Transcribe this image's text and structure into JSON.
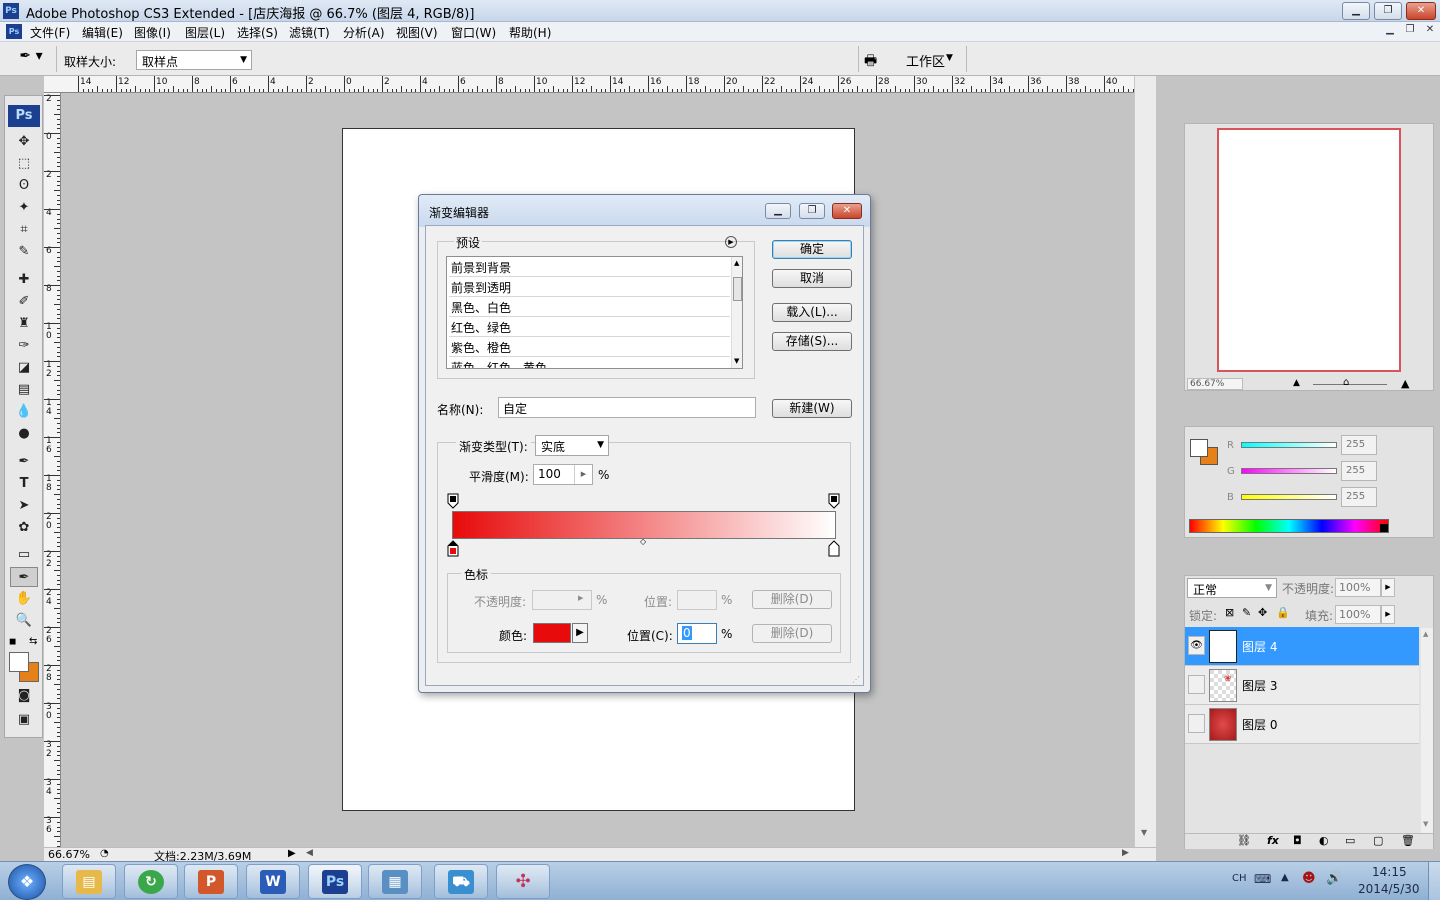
{
  "window": {
    "title": "Adobe Photoshop CS3 Extended - [店庆海报 @ 66.7% (图层 4, RGB/8)]",
    "ps_badge": "Ps"
  },
  "menu": [
    "文件(F)",
    "编辑(E)",
    "图像(I)",
    "图层(L)",
    "选择(S)",
    "滤镜(T)",
    "分析(A)",
    "视图(V)",
    "窗口(W)",
    "帮助(H)"
  ],
  "options": {
    "sample_size_label": "取样大小:",
    "sample_size_value": "取样点",
    "workspace": "工作区"
  },
  "toolbox": {
    "logo": "Ps",
    "tools": [
      "move-icon",
      "marquee-icon",
      "lasso-icon",
      "magic-wand-icon",
      "crop-icon",
      "slice-icon",
      "healing-brush-icon",
      "brush-icon",
      "clone-stamp-icon",
      "history-brush-icon",
      "eraser-icon",
      "gradient-icon",
      "blur-icon",
      "dodge-icon",
      "pen-icon",
      "type-icon",
      "path-select-icon",
      "shape-icon",
      "notes-icon",
      "eyedropper-icon",
      "hand-icon",
      "zoom-icon"
    ]
  },
  "rulers": {
    "h": [
      "14",
      "12",
      "10",
      "8",
      "6",
      "4",
      "2",
      "0",
      "2",
      "4",
      "6",
      "8",
      "10",
      "12",
      "14",
      "16",
      "18",
      "20",
      "22",
      "24",
      "26",
      "28",
      "30",
      "32",
      "34",
      "36",
      "38",
      "40"
    ],
    "v": [
      "2",
      "0",
      "2",
      "4",
      "6",
      "8",
      "1 0",
      "1 2",
      "1 4",
      "1 6",
      "1 8",
      "2 0",
      "2 2",
      "2 4",
      "2 6",
      "2 8",
      "3 0",
      "3 2",
      "3 4",
      "3 6"
    ]
  },
  "status": {
    "zoom": "66.67%",
    "doc": "文档:2.23M/3.69M"
  },
  "dialog": {
    "title": "渐变编辑器",
    "presets_label": "预设",
    "presets": [
      "前景到背景",
      "前景到透明",
      "黑色、白色",
      "红色、绿色",
      "紫色、橙色",
      "蓝色、红色、黄色"
    ],
    "buttons": {
      "ok": "确定",
      "cancel": "取消",
      "load": "载入(L)...",
      "save": "存储(S)...",
      "new": "新建(W)"
    },
    "name_label": "名称(N):",
    "name_value": "自定",
    "gradient_type_label": "渐变类型(T):",
    "gradient_type_value": "实底",
    "smoothness_label": "平滑度(M):",
    "smoothness_value": "100",
    "percent": "%",
    "stops_label": "色标",
    "opacity_label": "不透明度:",
    "position_label": "位置:",
    "delete_label": "删除(D)",
    "color_label": "颜色:",
    "position_c_label": "位置(C):",
    "position_c_value": "0",
    "gradient_start_color": "#e80b0b",
    "gradient_end_color": "#ffffff"
  },
  "navigator": {
    "zoom": "66.67%"
  },
  "color_panel": {
    "r_label": "R",
    "g_label": "G",
    "b_label": "B",
    "r": "255",
    "g": "255",
    "b": "255",
    "fg": "#ffffff",
    "bg": "#e8801a"
  },
  "layers_panel": {
    "blend_mode": "正常",
    "opacity_label": "不透明度:",
    "opacity": "100%",
    "lock_label": "锁定:",
    "fill_label": "填充:",
    "fill": "100%",
    "layers": [
      {
        "name": "图层 4",
        "selected": true,
        "visible": true
      },
      {
        "name": "图层 3",
        "selected": false,
        "visible": false
      },
      {
        "name": "图层 0",
        "selected": false,
        "visible": false
      }
    ]
  },
  "taskbar": {
    "apps": [
      "file-explorer-icon",
      "ie-icon",
      "powerpoint-icon",
      "word-icon",
      "photoshop-icon",
      "image-viewer-icon",
      "app-icon",
      "dragonfly-icon"
    ],
    "ps": "Ps",
    "ime": "CH",
    "time": "14:15",
    "date": "2014/5/30"
  }
}
